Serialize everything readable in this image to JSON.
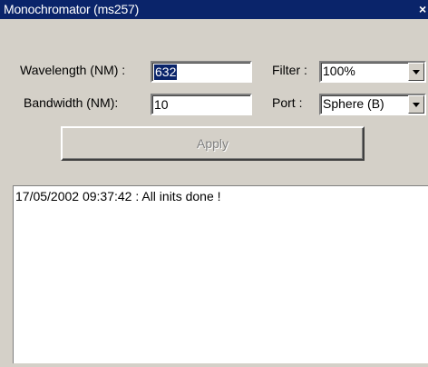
{
  "window": {
    "title": "Monochromator (ms257)",
    "close_glyph": "×"
  },
  "form": {
    "wavelength_label": "Wavelength (NM) :",
    "wavelength_value": "632",
    "bandwidth_label": "Bandwidth (NM):",
    "bandwidth_value": "10",
    "filter_label": "Filter :",
    "filter_value": "100%",
    "port_label": "Port :",
    "port_value": "Sphere (B)",
    "apply_label": "Apply"
  },
  "log": {
    "lines": [
      "17/05/2002 09:37:42 : All inits done !"
    ]
  },
  "colors": {
    "titlebar": "#0a246a",
    "face": "#d4d0c8",
    "disabled_text": "#808080"
  }
}
